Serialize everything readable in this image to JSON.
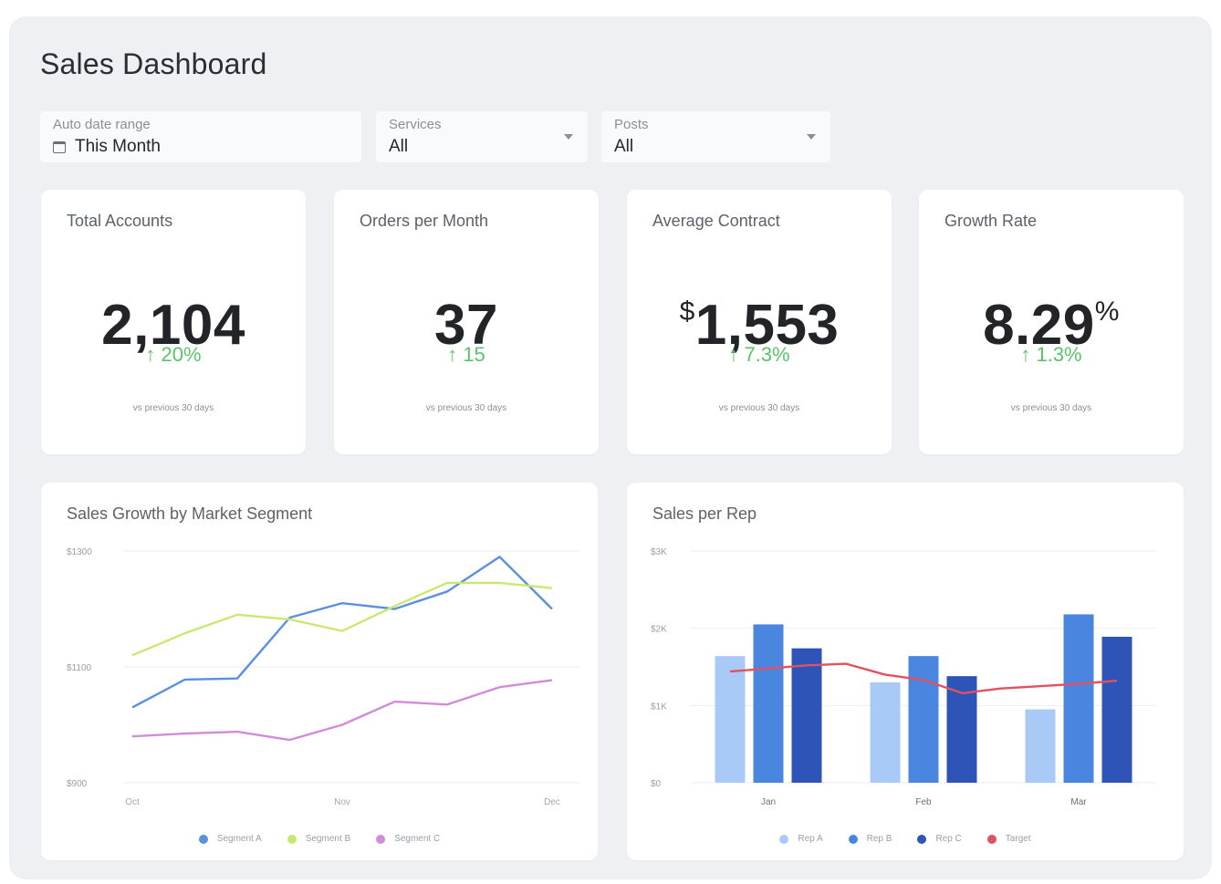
{
  "page": {
    "title": "Sales Dashboard"
  },
  "filters": {
    "date": {
      "label": "Auto date range",
      "value": "This Month",
      "icon": "calendar-icon"
    },
    "services": {
      "label": "Services",
      "value": "All",
      "icon": "chevron-down-icon"
    },
    "posts": {
      "label": "Posts",
      "value": "All",
      "icon": "chevron-down-icon"
    }
  },
  "kpis": [
    {
      "title": "Total Accounts",
      "prefix": "",
      "value": "2,104",
      "suffix": "",
      "delta": "↑ 20%",
      "sub": "vs previous 30 days"
    },
    {
      "title": "Orders per Month",
      "prefix": "",
      "value": "37",
      "suffix": "",
      "delta": "↑ 15",
      "sub": "vs previous 30 days"
    },
    {
      "title": "Average Contract",
      "prefix": "$",
      "value": "1,553",
      "suffix": "",
      "delta": "↑ 7.3%",
      "sub": "vs previous 30 days"
    },
    {
      "title": "Growth Rate",
      "prefix": "",
      "value": "8.29",
      "suffix": "%",
      "delta": "↑ 1.3%",
      "sub": "vs previous 30 days"
    }
  ],
  "colors": {
    "positive": "#5cc36a"
  },
  "chart_data": [
    {
      "type": "line",
      "title": "Sales Growth by Market Segment",
      "ylim": [
        900,
        1300
      ],
      "y_ticks": [
        "$1300",
        "$1100",
        "$900"
      ],
      "y_tick_values": [
        1300,
        1100,
        900
      ],
      "x_tick_labels": [
        "Oct",
        "Nov",
        "Dec"
      ],
      "x": [
        0,
        1,
        2,
        3,
        4,
        5,
        6,
        7,
        8
      ],
      "grid": true,
      "legend_position": "bottom",
      "series": [
        {
          "name": "Segment A",
          "color": "#5b8fe0",
          "values": [
            1030,
            1078,
            1080,
            1185,
            1210,
            1200,
            1230,
            1290,
            1200
          ]
        },
        {
          "name": "Segment B",
          "color": "#c9e870",
          "values": [
            1120,
            1158,
            1190,
            1182,
            1162,
            1205,
            1245,
            1245,
            1236
          ]
        },
        {
          "name": "Segment C",
          "color": "#d28bd8",
          "values": [
            980,
            985,
            988,
            974,
            1000,
            1040,
            1035,
            1065,
            1077
          ]
        }
      ]
    },
    {
      "type": "bar",
      "title": "Sales per Rep",
      "ylim": [
        0,
        3000
      ],
      "y_ticks": [
        "$3K",
        "$2K",
        "$1K",
        "$0"
      ],
      "y_tick_values": [
        3000,
        2000,
        1000,
        0
      ],
      "categories": [
        "Jan",
        "Feb",
        "Mar"
      ],
      "grid": true,
      "legend_position": "bottom",
      "series": [
        {
          "name": "Rep A",
          "color": "#a9c9f7",
          "values": [
            1640,
            1300,
            950
          ]
        },
        {
          "name": "Rep B",
          "color": "#4a86e0",
          "values": [
            2050,
            1640,
            2180
          ]
        },
        {
          "name": "Rep C",
          "color": "#2e54b8",
          "values": [
            1740,
            1380,
            1890
          ]
        }
      ],
      "line_series": {
        "name": "Target",
        "color": "#e05260",
        "x": [
          0,
          0.5,
          1,
          1.5,
          2,
          2.5,
          3,
          3.5,
          4,
          4.5,
          5
        ],
        "values": [
          1440,
          1480,
          1520,
          1540,
          1400,
          1330,
          1160,
          1220,
          1250,
          1280,
          1320
        ]
      }
    }
  ]
}
